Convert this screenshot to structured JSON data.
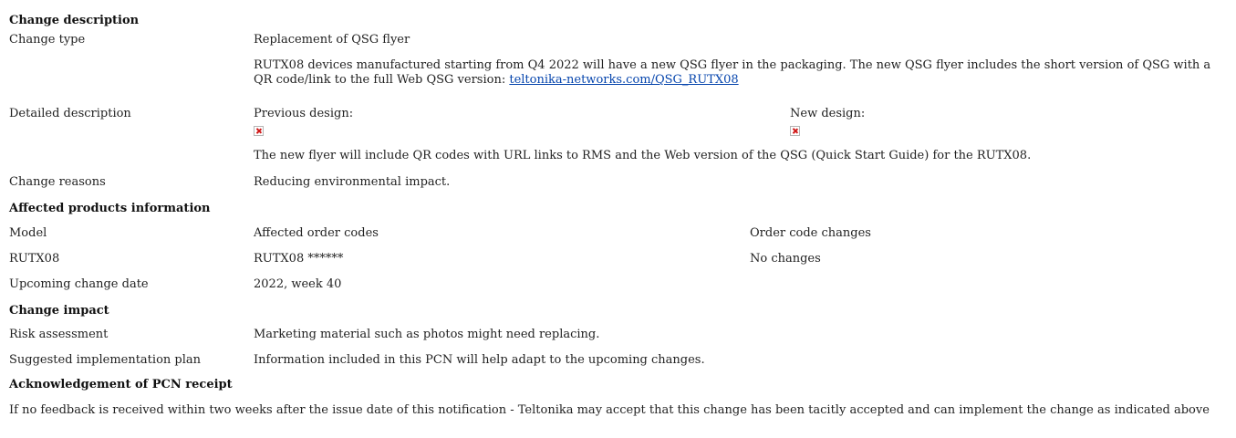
{
  "change_description": {
    "header": "Change description",
    "change_type_label": "Change type",
    "change_type_value": "Replacement of QSG flyer",
    "change_type_detail": "RUTX08 devices manufactured starting from Q4 2022 will have a new QSG flyer in the packaging. The new QSG flyer includes the short version of QSG with a QR code/link to the full Web QSG version: ",
    "change_type_link": "teltonika-networks.com/QSG_RUTX08",
    "detailed_label": "Detailed description",
    "previous_design": "Previous design:",
    "new_design": "New design:",
    "detailed_text": "The new flyer will include QR codes with URL links to RMS and the Web version of the QSG (Quick Start Guide) for the RUTX08.",
    "reasons_label": "Change reasons",
    "reasons_value": "Reducing environmental impact."
  },
  "affected_products": {
    "header": "Affected products information",
    "columns": [
      "Model",
      "Affected order codes",
      "Order code changes"
    ],
    "row": [
      "RUTX08",
      "RUTX08 ******",
      "No changes"
    ],
    "upcoming_label": "Upcoming change date",
    "upcoming_value": "2022, week 40"
  },
  "change_impact": {
    "header": "Change impact",
    "risk_label": "Risk assessment",
    "risk_value": "Marketing material such as photos might need replacing.",
    "plan_label": "Suggested implementation plan",
    "plan_value": "Information included in this PCN will help adapt to the upcoming changes."
  },
  "acknowledgement": {
    "header": "Acknowledgement of PCN receipt",
    "text": "If no feedback is received within two weeks after the issue date of this notification - Teltonika may accept that this change has been tacitly accepted and can implement the change as indicated above"
  },
  "icons": {
    "broken_image": "broken-image-icon"
  }
}
